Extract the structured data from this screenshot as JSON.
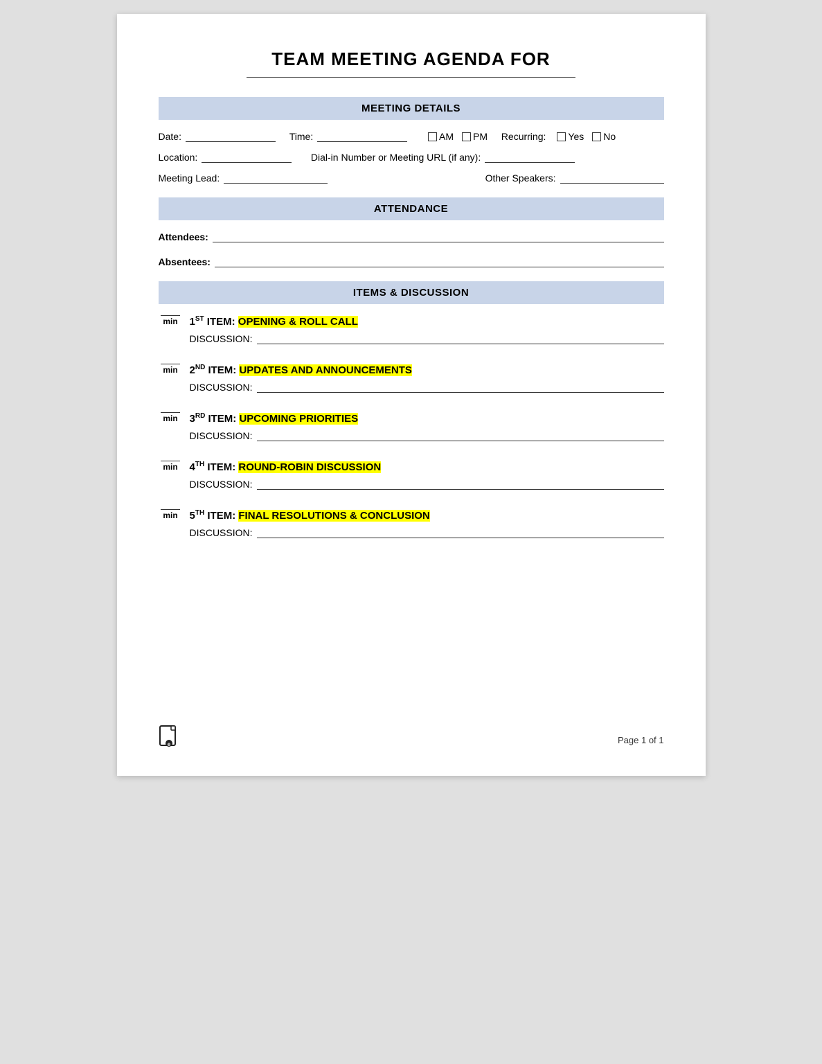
{
  "title": "TEAM MEETING AGENDA FOR",
  "sections": {
    "meeting_details": {
      "header": "MEETING DETAILS",
      "fields": {
        "date_label": "Date:",
        "time_label": "Time:",
        "am_label": "AM",
        "pm_label": "PM",
        "recurring_label": "Recurring:",
        "yes_label": "Yes",
        "no_label": "No",
        "location_label": "Location:",
        "dialin_label": "Dial-in Number or Meeting URL (if any):",
        "meeting_lead_label": "Meeting Lead:",
        "other_speakers_label": "Other Speakers:"
      }
    },
    "attendance": {
      "header": "ATTENDANCE",
      "attendees_label": "Attendees:",
      "absentees_label": "Absentees:"
    },
    "items_discussion": {
      "header": "ITEMS & DISCUSSION",
      "items": [
        {
          "number": "1",
          "sup": "ST",
          "title": "ITEM: ",
          "highlight": "OPENING & ROLL CALL",
          "discussion_label": "DISCUSSION:"
        },
        {
          "number": "2",
          "sup": "ND",
          "title": "ITEM: ",
          "highlight": "UPDATES AND ANNOUNCEMENTS",
          "discussion_label": "DISCUSSION:"
        },
        {
          "number": "3",
          "sup": "RD",
          "title": "ITEM: ",
          "highlight": "UPCOMING PRIORITIES",
          "discussion_label": "DISCUSSION:"
        },
        {
          "number": "4",
          "sup": "TH",
          "title": "ITEM: ",
          "highlight": "ROUND-ROBIN DISCUSSION",
          "discussion_label": "DISCUSSION:"
        },
        {
          "number": "5",
          "sup": "TH",
          "title": "ITEM: ",
          "highlight": "FINAL RESOLUTIONS & CONCLUSION",
          "discussion_label": "DISCUSSION:"
        }
      ]
    }
  },
  "footer": {
    "page_label": "Page 1 of 1"
  }
}
